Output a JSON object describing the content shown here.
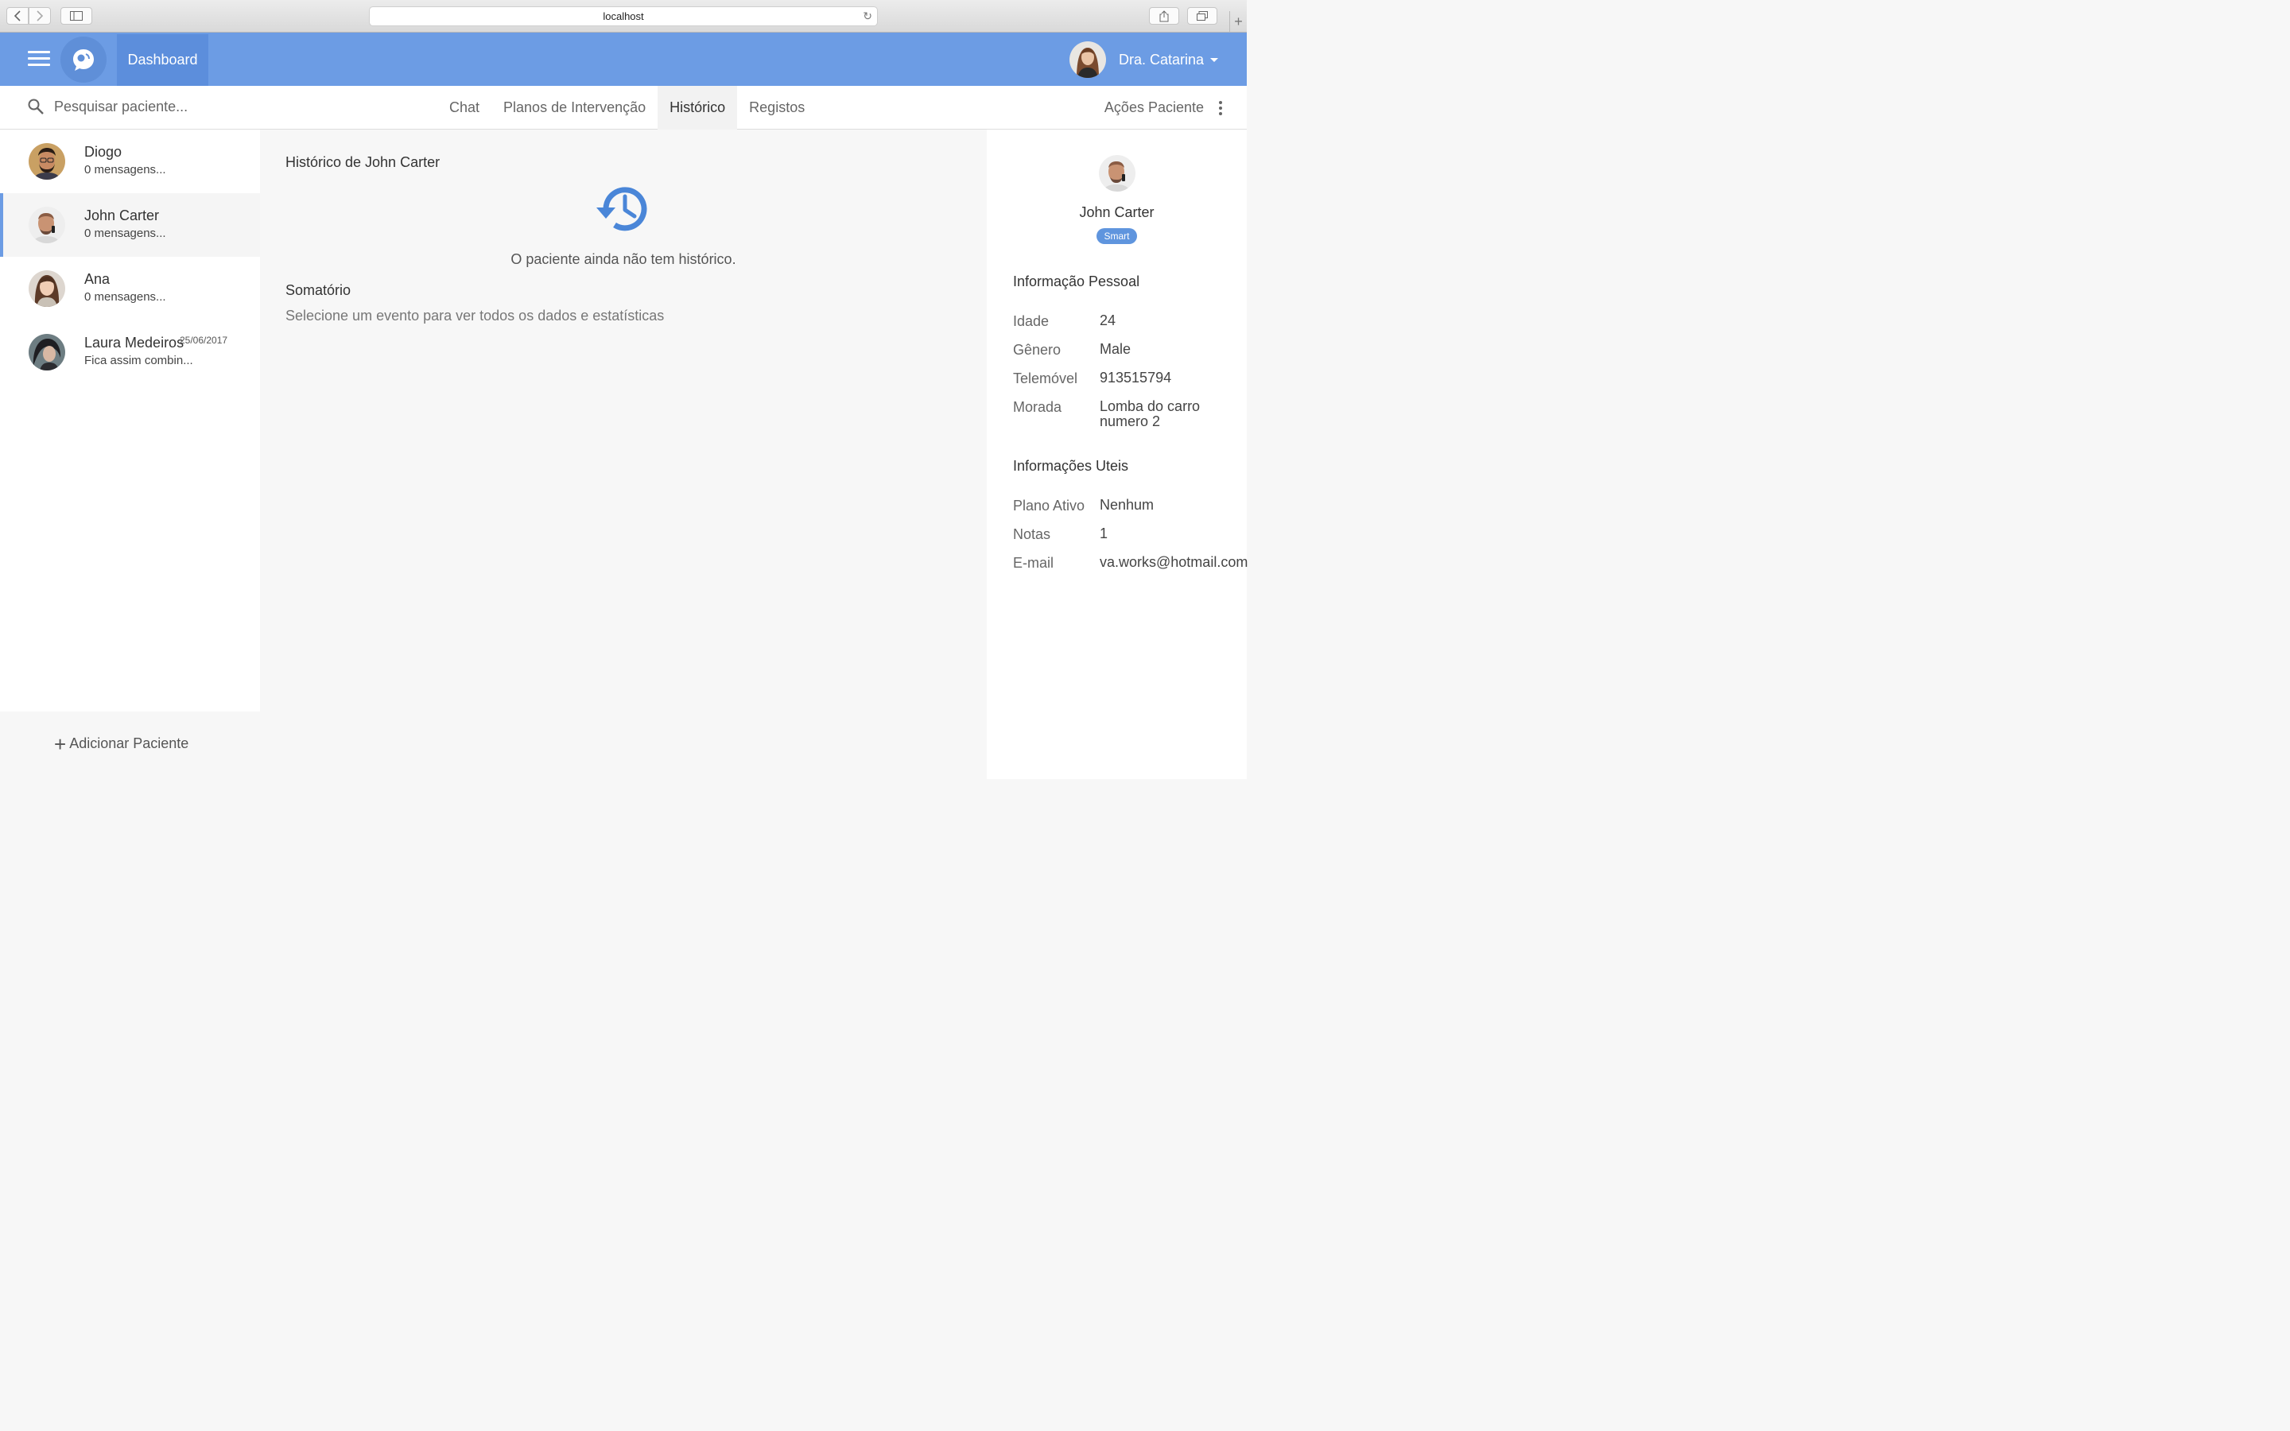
{
  "browser": {
    "url": "localhost"
  },
  "header": {
    "dashboard_label": "Dashboard",
    "user_name": "Dra. Catarina",
    "brand_color": "#6c9ce4"
  },
  "subnav": {
    "search_placeholder": "Pesquisar paciente...",
    "tabs": [
      {
        "label": "Chat",
        "active": false
      },
      {
        "label": "Planos de Intervenção",
        "active": false
      },
      {
        "label": "Histórico",
        "active": true
      },
      {
        "label": "Registos",
        "active": false
      }
    ],
    "actions_label": "Ações Paciente"
  },
  "patients": [
    {
      "name": "Diogo",
      "message": "0 mensagens...",
      "date": ""
    },
    {
      "name": "John Carter",
      "message": "0 mensagens...",
      "date": "",
      "active": true
    },
    {
      "name": "Ana",
      "message": "0 mensagens...",
      "date": ""
    },
    {
      "name": "Laura Medeiros",
      "message": "Fica assim combin...",
      "date": "25/06/2017"
    }
  ],
  "add_patient_label": "Adicionar Paciente",
  "main": {
    "title": "Histórico de John Carter",
    "empty_text": "O paciente ainda não tem histórico.",
    "summary_title": "Somatório",
    "summary_text": "Selecione um evento para ver todos os dados e estatísticas"
  },
  "profile": {
    "name": "John Carter",
    "badge": "Smart",
    "personal_title": "Informação Pessoal",
    "personal": [
      {
        "label": "Idade",
        "value": "24"
      },
      {
        "label": "Gênero",
        "value": "Male"
      },
      {
        "label": "Telemóvel",
        "value": "913515794"
      },
      {
        "label": "Morada",
        "value": "Lomba do carro numero 2"
      }
    ],
    "useful_title": "Informações Uteis",
    "useful": [
      {
        "label": "Plano Ativo",
        "value": "Nenhum"
      },
      {
        "label": "Notas",
        "value": "1"
      },
      {
        "label": "E-mail",
        "value": "va.works@hotmail.com"
      }
    ]
  }
}
